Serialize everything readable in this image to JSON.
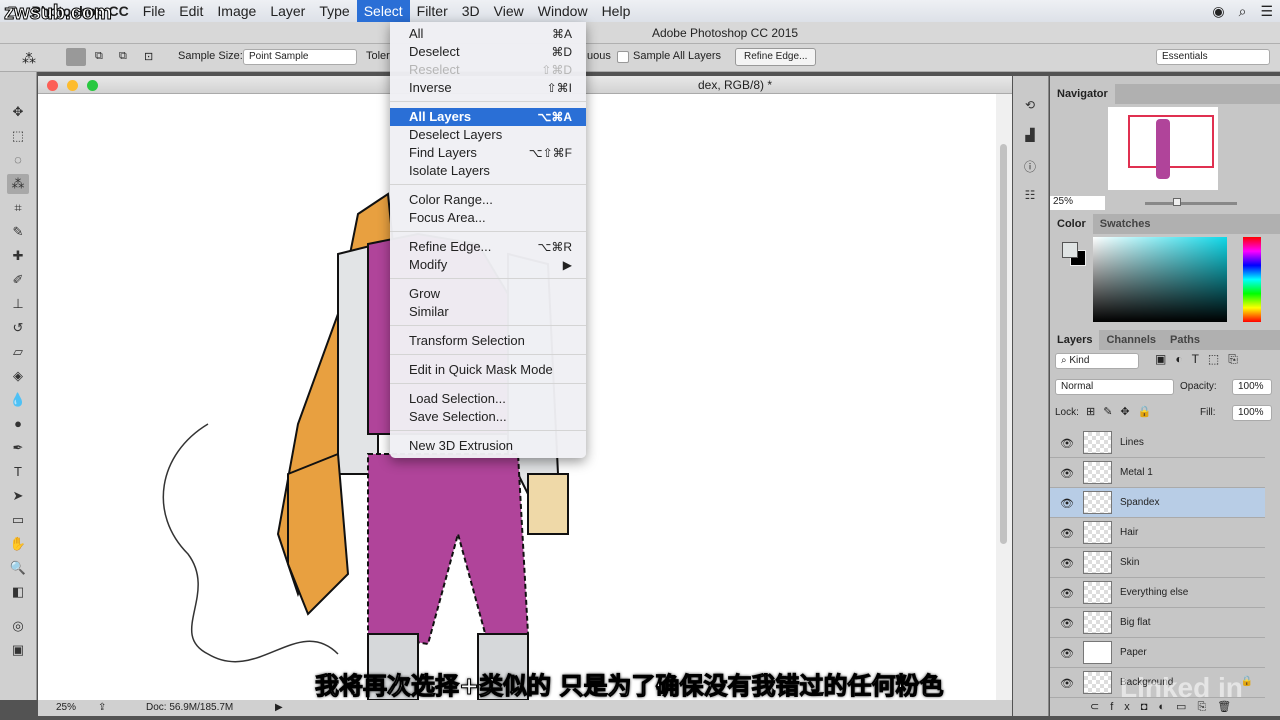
{
  "watermark": "zwsub.com",
  "menubar": {
    "app": "Photoshop CC",
    "items": [
      "File",
      "Edit",
      "Image",
      "Layer",
      "Type",
      "Select",
      "Filter",
      "3D",
      "View",
      "Window",
      "Help"
    ],
    "active": "Select"
  },
  "window_title": "Adobe Photoshop CC 2015",
  "options": {
    "sample_size_label": "Sample Size:",
    "sample_size_value": "Point Sample",
    "tolerance_label": "Toler",
    "contiguous_label": "uous",
    "sample_all_layers": "Sample All Layers",
    "refine_edge": "Refine Edge...",
    "workspace": "Essentials"
  },
  "document": {
    "title": "dex, RGB/8) *",
    "zoom": "25%",
    "doc_size": "Doc: 56.9M/185.7M"
  },
  "select_menu": [
    {
      "label": "All",
      "shortcut": "⌘A"
    },
    {
      "label": "Deselect",
      "shortcut": "⌘D"
    },
    {
      "label": "Reselect",
      "shortcut": "⇧⌘D",
      "disabled": true
    },
    {
      "label": "Inverse",
      "shortcut": "⇧⌘I"
    },
    {
      "label": "All Layers",
      "shortcut": "⌥⌘A",
      "highlighted": true
    },
    {
      "label": "Deselect Layers",
      "shortcut": ""
    },
    {
      "label": "Find Layers",
      "shortcut": "⌥⇧⌘F"
    },
    {
      "label": "Isolate Layers",
      "shortcut": ""
    },
    {
      "label": "Color Range...",
      "shortcut": ""
    },
    {
      "label": "Focus Area...",
      "shortcut": ""
    },
    {
      "label": "Refine Edge...",
      "shortcut": "⌥⌘R"
    },
    {
      "label": "Modify",
      "shortcut": "▶"
    },
    {
      "label": "Grow",
      "shortcut": ""
    },
    {
      "label": "Similar",
      "shortcut": ""
    },
    {
      "label": "Transform Selection",
      "shortcut": ""
    },
    {
      "label": "Edit in Quick Mask Mode",
      "shortcut": ""
    },
    {
      "label": "Load Selection...",
      "shortcut": ""
    },
    {
      "label": "Save Selection...",
      "shortcut": ""
    },
    {
      "label": "New 3D Extrusion",
      "shortcut": ""
    }
  ],
  "navigator": {
    "tab": "Navigator",
    "zoom": "25%"
  },
  "color": {
    "tabs": [
      "Color",
      "Swatches"
    ]
  },
  "layers": {
    "tabs": [
      "Layers",
      "Channels",
      "Paths"
    ],
    "filter": "Kind",
    "blend_mode": "Normal",
    "opacity_label": "Opacity:",
    "opacity": "100%",
    "lock_label": "Lock:",
    "fill_label": "Fill:",
    "fill": "100%",
    "items": [
      {
        "name": "Lines"
      },
      {
        "name": "Metal 1"
      },
      {
        "name": "Spandex",
        "selected": true
      },
      {
        "name": "Hair"
      },
      {
        "name": "Skin"
      },
      {
        "name": "Everything else"
      },
      {
        "name": "Big flat"
      },
      {
        "name": "Paper"
      },
      {
        "name": "Background",
        "locked": true
      }
    ]
  },
  "subtitle": "我将再次选择+类似的  只是为了确保没有我错过的任何粉色",
  "brand": "Linked in",
  "colors": {
    "accent": "#2a6fd6",
    "spandex": "#b0449a",
    "metal": "#e8a040"
  }
}
